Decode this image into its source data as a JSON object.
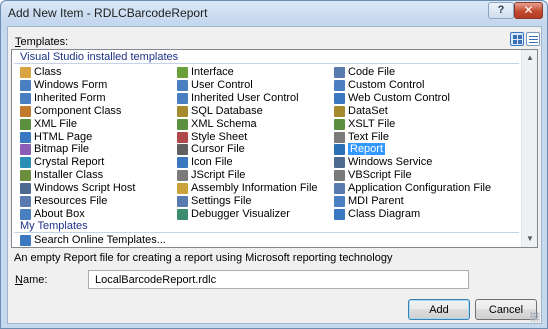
{
  "window": {
    "title": "Add New Item - RDLCBarcodeReport",
    "help_label": "?",
    "close_label": "✕"
  },
  "templates_label": {
    "accel": "T",
    "rest": "emplates:"
  },
  "groups": {
    "installed": "Visual Studio installed templates",
    "mine": "My Templates"
  },
  "columns": [
    [
      {
        "label": "Class",
        "icon": "class-icon",
        "color": "#d9a441"
      },
      {
        "label": "Windows Form",
        "icon": "windows-form-icon",
        "color": "#4a7fc1"
      },
      {
        "label": "Inherited Form",
        "icon": "inherited-form-icon",
        "color": "#4a7fc1"
      },
      {
        "label": "Component Class",
        "icon": "component-class-icon",
        "color": "#c27a2c"
      },
      {
        "label": "XML File",
        "icon": "xml-file-icon",
        "color": "#5c8f3e"
      },
      {
        "label": "HTML Page",
        "icon": "html-page-icon",
        "color": "#3b78c2"
      },
      {
        "label": "Bitmap File",
        "icon": "bitmap-file-icon",
        "color": "#8a5cb6"
      },
      {
        "label": "Crystal Report",
        "icon": "crystal-report-icon",
        "color": "#2b8fb5"
      },
      {
        "label": "Installer Class",
        "icon": "installer-class-icon",
        "color": "#6a8e3b"
      },
      {
        "label": "Windows Script Host",
        "icon": "script-host-icon",
        "color": "#4f6a8f"
      },
      {
        "label": "Resources File",
        "icon": "resources-file-icon",
        "color": "#5a7bb0"
      },
      {
        "label": "About Box",
        "icon": "about-box-icon",
        "color": "#4a7fc1"
      }
    ],
    [
      {
        "label": "Interface",
        "icon": "interface-icon",
        "color": "#6b9f3a"
      },
      {
        "label": "User Control",
        "icon": "user-control-icon",
        "color": "#4a7fc1"
      },
      {
        "label": "Inherited User Control",
        "icon": "inherited-user-control-icon",
        "color": "#4a7fc1"
      },
      {
        "label": "SQL Database",
        "icon": "sql-database-icon",
        "color": "#a58a2e"
      },
      {
        "label": "XML Schema",
        "icon": "xml-schema-icon",
        "color": "#5c8f3e"
      },
      {
        "label": "Style Sheet",
        "icon": "style-sheet-icon",
        "color": "#b04a4a"
      },
      {
        "label": "Cursor File",
        "icon": "cursor-file-icon",
        "color": "#606060"
      },
      {
        "label": "Icon File",
        "icon": "icon-file-icon",
        "color": "#3b78c2"
      },
      {
        "label": "JScript File",
        "icon": "jscript-file-icon",
        "color": "#7a7a7a"
      },
      {
        "label": "Assembly Information File",
        "icon": "assembly-info-icon",
        "color": "#c9a23c"
      },
      {
        "label": "Settings File",
        "icon": "settings-file-icon",
        "color": "#5a7bb0"
      },
      {
        "label": "Debugger Visualizer",
        "icon": "debugger-visualizer-icon",
        "color": "#3c8d6e"
      }
    ],
    [
      {
        "label": "Code File",
        "icon": "code-file-icon",
        "color": "#5a7bb0"
      },
      {
        "label": "Custom Control",
        "icon": "custom-control-icon",
        "color": "#4a7fc1"
      },
      {
        "label": "Web Custom Control",
        "icon": "web-custom-control-icon",
        "color": "#3b78c2"
      },
      {
        "label": "DataSet",
        "icon": "dataset-icon",
        "color": "#a58a2e"
      },
      {
        "label": "XSLT File",
        "icon": "xslt-file-icon",
        "color": "#5c8f3e"
      },
      {
        "label": "Text File",
        "icon": "text-file-icon",
        "color": "#7a7a7a"
      },
      {
        "label": "Report",
        "icon": "report-icon",
        "color": "#2b6fb5",
        "selected": true
      },
      {
        "label": "Windows Service",
        "icon": "windows-service-icon",
        "color": "#4f6a8f"
      },
      {
        "label": "VBScript File",
        "icon": "vbscript-file-icon",
        "color": "#7a7a7a"
      },
      {
        "label": "Application Configuration File",
        "icon": "app-config-icon",
        "color": "#5a7bb0"
      },
      {
        "label": "MDI Parent",
        "icon": "mdi-parent-icon",
        "color": "#4a7fc1"
      },
      {
        "label": "Class Diagram",
        "icon": "class-diagram-icon",
        "color": "#3b78c2"
      }
    ]
  ],
  "my_templates": [
    {
      "label": "Search Online Templates...",
      "icon": "search-online-icon",
      "color": "#3b78c2"
    }
  ],
  "description": "An empty Report file for creating a report using Microsoft reporting technology",
  "name_label": {
    "accel": "N",
    "rest": "ame:"
  },
  "name_value": "LocalBarcodeReport.rdlc",
  "buttons": {
    "add": "Add",
    "cancel": "Cancel"
  }
}
